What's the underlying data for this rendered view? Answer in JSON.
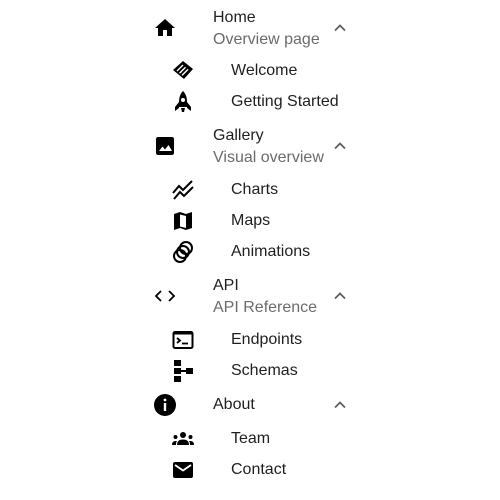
{
  "sections": [
    {
      "title": "Home",
      "subtitle": "Overview page",
      "icon": "home-icon",
      "expanded": true,
      "children": [
        {
          "label": "Welcome",
          "icon": "handshake-icon"
        },
        {
          "label": "Getting Started",
          "icon": "rocket-icon"
        }
      ]
    },
    {
      "title": "Gallery",
      "subtitle": "Visual overview",
      "icon": "image-icon",
      "expanded": true,
      "children": [
        {
          "label": "Charts",
          "icon": "chart-line-icon"
        },
        {
          "label": "Maps",
          "icon": "map-icon"
        },
        {
          "label": "Animations",
          "icon": "animation-icon"
        }
      ]
    },
    {
      "title": "API",
      "subtitle": "API Reference",
      "icon": "code-icon",
      "expanded": true,
      "children": [
        {
          "label": "Endpoints",
          "icon": "terminal-icon"
        },
        {
          "label": "Schemas",
          "icon": "schema-icon"
        }
      ]
    },
    {
      "title": "About",
      "subtitle": "",
      "icon": "info-icon",
      "expanded": true,
      "children": [
        {
          "label": "Team",
          "icon": "groups-icon"
        },
        {
          "label": "Contact",
          "icon": "mail-icon"
        }
      ]
    }
  ],
  "colors": {
    "text": "#1f1f1f",
    "secondary_text": "#6b6b6b",
    "icon": "#000000",
    "chevron": "#5f5f5f"
  }
}
